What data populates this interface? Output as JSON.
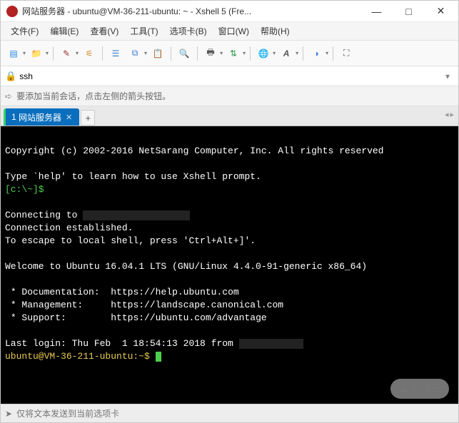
{
  "window": {
    "title": "网站服务器 - ubuntu@VM-36-211-ubuntu: ~ - Xshell 5 (Fre..."
  },
  "menu": {
    "items": [
      {
        "label": "文件(F)"
      },
      {
        "label": "编辑(E)"
      },
      {
        "label": "查看(V)"
      },
      {
        "label": "工具(T)"
      },
      {
        "label": "选项卡(B)"
      },
      {
        "label": "窗口(W)"
      },
      {
        "label": "帮助(H)"
      }
    ]
  },
  "address": {
    "prefix": "ssh"
  },
  "prompt_bar": {
    "text": "要添加当前会话，点击左侧的箭头按钮。"
  },
  "tabs": {
    "active": {
      "index": "1",
      "label": "网站服务器"
    }
  },
  "terminal": {
    "copyright": "Copyright (c) 2002-2016 NetSarang Computer, Inc. All rights reserved",
    "help_line": "Type `help' to learn how to use Xshell prompt.",
    "local_prompt": "[c:\\~]$",
    "connecting_prefix": "Connecting to",
    "conn_established": "Connection established.",
    "escape_hint": "To escape to local shell, press 'Ctrl+Alt+]'.",
    "welcome": "Welcome to Ubuntu 16.04.1 LTS (GNU/Linux 4.4.0-91-generic x86_64)",
    "links": {
      "doc_label": " * Documentation:  ",
      "doc_url": "https://help.ubuntu.com",
      "mgmt_label": " * Management:     ",
      "mgmt_url": "https://landscape.canonical.com",
      "support_label": " * Support:        ",
      "support_url": "https://ubuntu.com/advantage"
    },
    "last_login_prefix": "Last login: Thu Feb  1 18:54:13 2018 from ",
    "remote_prompt": "ubuntu@VM-36-211-ubuntu:~$ "
  },
  "cmdbar": {
    "placeholder": "仅将文本发送到当前选项卡"
  },
  "watermark": {
    "text": "亿速云"
  }
}
